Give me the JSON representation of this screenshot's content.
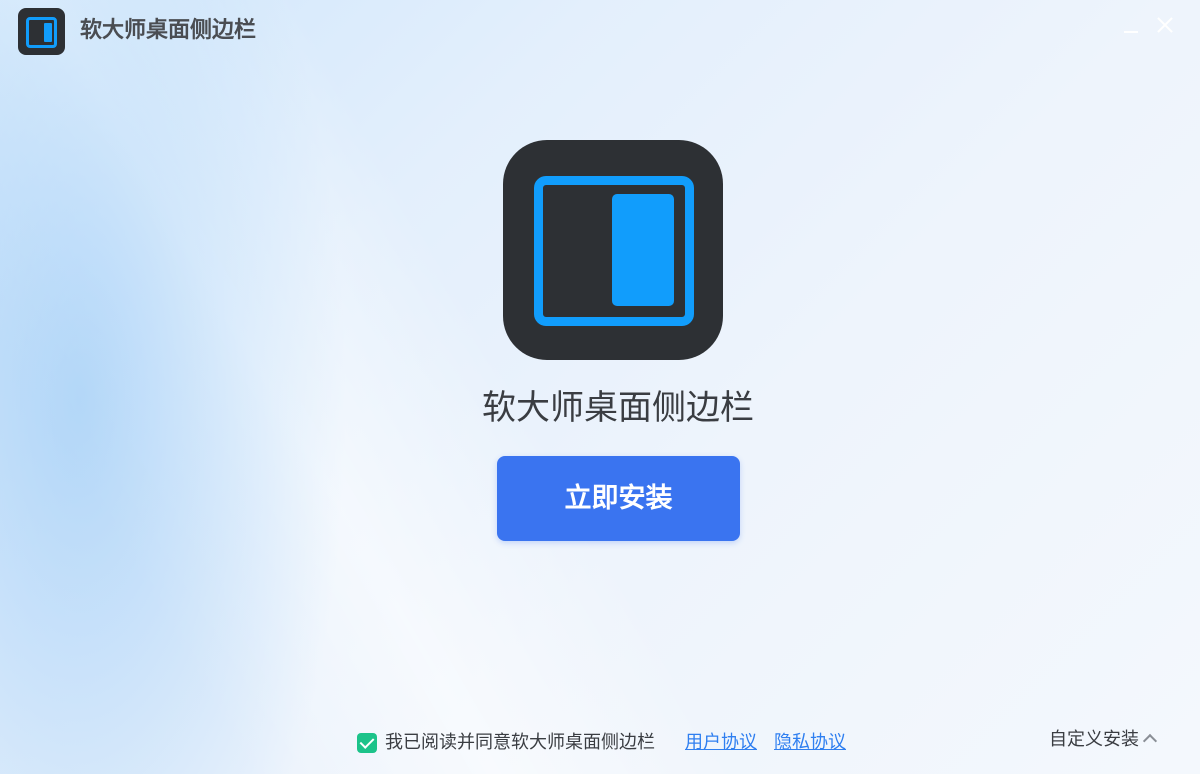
{
  "window": {
    "title": "软大师桌面侧边栏"
  },
  "icons": {
    "app_icon": "sidebar-app-icon",
    "minimize": "minimize-icon",
    "close": "close-icon",
    "checkbox": "checkbox-checked-icon",
    "chevron": "chevron-up-icon"
  },
  "main": {
    "app_name": "软大师桌面侧边栏",
    "install_button_label": "立即安装"
  },
  "footer": {
    "agree_checked": true,
    "agree_text": "我已阅读并同意软大师桌面侧边栏",
    "user_agreement_link": "用户协议",
    "privacy_policy_link": "隐私协议",
    "custom_install_label": "自定义安装"
  },
  "colors": {
    "accent_blue": "#3a74f0",
    "icon_blue": "#119dfc",
    "icon_dark": "#2d3034",
    "checkbox_green": "#1cc38a",
    "link_blue": "#2f7ff0"
  }
}
